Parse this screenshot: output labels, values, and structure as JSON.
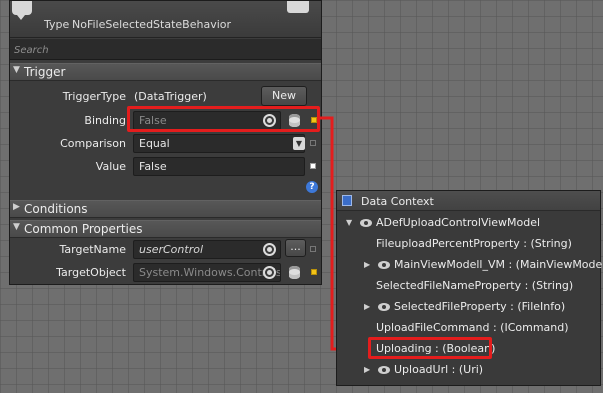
{
  "header": {
    "type_label": "Type",
    "type_value": "NoFileSelectedStateBehavior"
  },
  "search": {
    "placeholder": "Search"
  },
  "trigger": {
    "section_title": "Trigger",
    "trigger_type_label": "TriggerType",
    "trigger_type_value": "(DataTrigger)",
    "new_button": "New",
    "binding_label": "Binding",
    "binding_value": "False",
    "comparison_label": "Comparison",
    "comparison_value": "Equal",
    "value_label": "Value",
    "value_value": "False"
  },
  "conditions": {
    "section_title": "Conditions"
  },
  "common": {
    "section_title": "Common Properties",
    "target_name_label": "TargetName",
    "target_name_value": "userControl",
    "ellipsis_button": "...",
    "target_object_label": "TargetObject",
    "target_object_value": "System.Windows.Controls"
  },
  "help_icon": "?",
  "data_context": {
    "title": "Data Context",
    "items": [
      {
        "label": "ADefUploadControlViewModel",
        "expander": "expanded",
        "icon": "eye-icon"
      },
      {
        "label": "FileuploadPercentProperty : (String)",
        "expander": "none",
        "icon": ""
      },
      {
        "label": "MainViewModell_VM : (MainViewModel)",
        "expander": "collapsed",
        "icon": "eye-icon"
      },
      {
        "label": "SelectedFileNameProperty : (String)",
        "expander": "none",
        "icon": ""
      },
      {
        "label": "SelectedFileProperty : (FileInfo)",
        "expander": "collapsed",
        "icon": "eye-icon"
      },
      {
        "label": "UploadFileCommand : (ICommand)",
        "expander": "none",
        "icon": ""
      },
      {
        "label": "Uploading : (Boolean)",
        "expander": "none",
        "icon": "",
        "highlighted": true
      },
      {
        "label": "UploadUrl : (Uri)",
        "expander": "collapsed",
        "icon": "eye-icon"
      }
    ]
  },
  "colors": {
    "highlight": "#e41d1d",
    "marker_yellow": "#f2c318",
    "panel": "#3c3c3c",
    "canvas": "#6f6f6f"
  }
}
